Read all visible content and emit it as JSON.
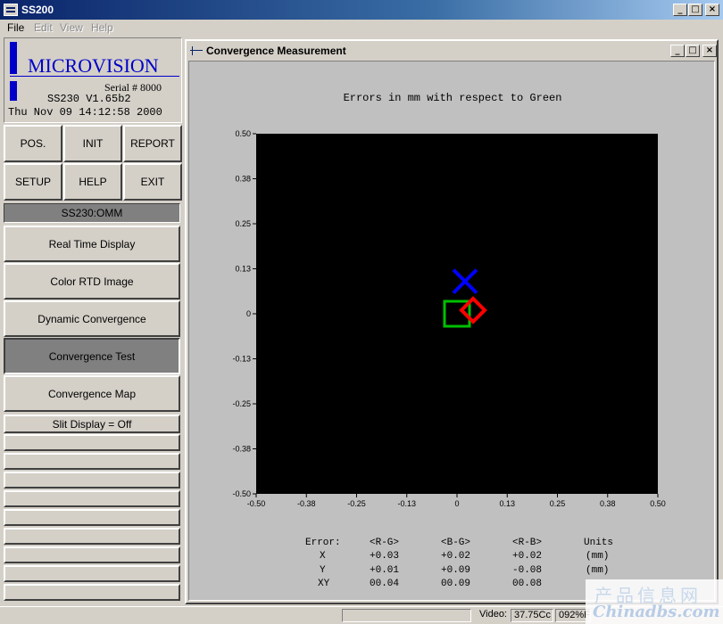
{
  "window": {
    "title": "SS200"
  },
  "menu": [
    {
      "label": "File",
      "enabled": true
    },
    {
      "label": "Edit",
      "enabled": false
    },
    {
      "label": "View",
      "enabled": false
    },
    {
      "label": "Help",
      "enabled": false
    }
  ],
  "logo": {
    "brand": "MICROVISION",
    "serial": "Serial # 8000",
    "version": "SS230 V1.65b2",
    "datetime": "Thu Nov 09 14:12:58 2000"
  },
  "buttons": {
    "pos": "POS.",
    "init": "INIT",
    "report": "REPORT",
    "setup": "SETUP",
    "help": "HELP",
    "exit": "EXIT"
  },
  "mode_status": "SS230:OMM",
  "functions": [
    {
      "label": "Real Time Display",
      "active": false
    },
    {
      "label": "Color RTD Image",
      "active": false
    },
    {
      "label": "Dynamic Convergence",
      "active": false
    },
    {
      "label": "Convergence Test",
      "active": true
    },
    {
      "label": "Convergence Map",
      "active": false
    }
  ],
  "slit_display": "Slit Display = Off",
  "child_window": {
    "title": "Convergence Measurement"
  },
  "chart_data": {
    "type": "scatter",
    "title": "Errors in mm with respect to Green",
    "xlim": [
      -0.5,
      0.5
    ],
    "ylim": [
      -0.5,
      0.5
    ],
    "x_ticks": [
      "-0.50",
      "-0.38",
      "-0.25",
      "-0.13",
      "0",
      "0.13",
      "0.25",
      "0.38",
      "0.50"
    ],
    "y_ticks": [
      "0.50",
      "0.38",
      "0.25",
      "0.13",
      "0",
      "-0.13",
      "-0.25",
      "-0.38",
      "-0.50"
    ],
    "background": "#000000",
    "markers": [
      {
        "shape": "x",
        "color": "#0000ff",
        "x": 0.02,
        "y": 0.09
      },
      {
        "shape": "square",
        "color": "#00c000",
        "x": 0.0,
        "y": 0.0
      },
      {
        "shape": "diamond",
        "color": "#ff0000",
        "x": 0.04,
        "y": 0.01
      }
    ]
  },
  "error_table": {
    "headers": [
      "Error:",
      "<R-G>",
      "<B-G>",
      "<R-B>",
      "Units"
    ],
    "rows": [
      [
        "X",
        "+0.03",
        "+0.02",
        "+0.02",
        "(mm)"
      ],
      [
        "Y",
        "+0.01",
        "+0.09",
        "-0.08",
        "(mm)"
      ],
      [
        "XY",
        "00.04",
        "00.09",
        "00.08",
        ""
      ]
    ]
  },
  "statusbar": {
    "video_label": "Video:",
    "video_value": "37.75Cc",
    "extra": "092%F"
  },
  "watermark": {
    "line1": "产品信息网",
    "line2": "Chinadbs.com"
  }
}
